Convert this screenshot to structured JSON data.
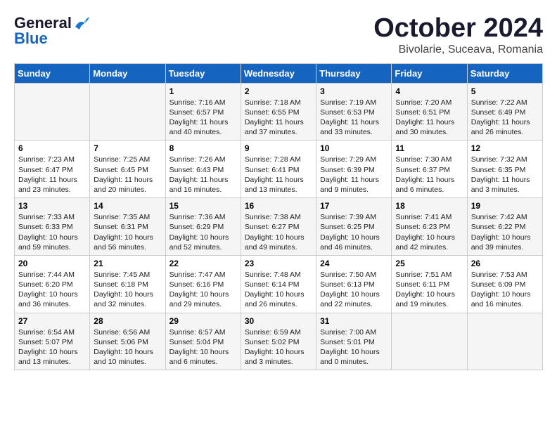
{
  "header": {
    "logo_line1": "General",
    "logo_line2": "Blue",
    "month": "October 2024",
    "location": "Bivolarie, Suceava, Romania"
  },
  "weekdays": [
    "Sunday",
    "Monday",
    "Tuesday",
    "Wednesday",
    "Thursday",
    "Friday",
    "Saturday"
  ],
  "weeks": [
    [
      {
        "day": "",
        "info": ""
      },
      {
        "day": "",
        "info": ""
      },
      {
        "day": "1",
        "info": "Sunrise: 7:16 AM\nSunset: 6:57 PM\nDaylight: 11 hours and 40 minutes."
      },
      {
        "day": "2",
        "info": "Sunrise: 7:18 AM\nSunset: 6:55 PM\nDaylight: 11 hours and 37 minutes."
      },
      {
        "day": "3",
        "info": "Sunrise: 7:19 AM\nSunset: 6:53 PM\nDaylight: 11 hours and 33 minutes."
      },
      {
        "day": "4",
        "info": "Sunrise: 7:20 AM\nSunset: 6:51 PM\nDaylight: 11 hours and 30 minutes."
      },
      {
        "day": "5",
        "info": "Sunrise: 7:22 AM\nSunset: 6:49 PM\nDaylight: 11 hours and 26 minutes."
      }
    ],
    [
      {
        "day": "6",
        "info": "Sunrise: 7:23 AM\nSunset: 6:47 PM\nDaylight: 11 hours and 23 minutes."
      },
      {
        "day": "7",
        "info": "Sunrise: 7:25 AM\nSunset: 6:45 PM\nDaylight: 11 hours and 20 minutes."
      },
      {
        "day": "8",
        "info": "Sunrise: 7:26 AM\nSunset: 6:43 PM\nDaylight: 11 hours and 16 minutes."
      },
      {
        "day": "9",
        "info": "Sunrise: 7:28 AM\nSunset: 6:41 PM\nDaylight: 11 hours and 13 minutes."
      },
      {
        "day": "10",
        "info": "Sunrise: 7:29 AM\nSunset: 6:39 PM\nDaylight: 11 hours and 9 minutes."
      },
      {
        "day": "11",
        "info": "Sunrise: 7:30 AM\nSunset: 6:37 PM\nDaylight: 11 hours and 6 minutes."
      },
      {
        "day": "12",
        "info": "Sunrise: 7:32 AM\nSunset: 6:35 PM\nDaylight: 11 hours and 3 minutes."
      }
    ],
    [
      {
        "day": "13",
        "info": "Sunrise: 7:33 AM\nSunset: 6:33 PM\nDaylight: 10 hours and 59 minutes."
      },
      {
        "day": "14",
        "info": "Sunrise: 7:35 AM\nSunset: 6:31 PM\nDaylight: 10 hours and 56 minutes."
      },
      {
        "day": "15",
        "info": "Sunrise: 7:36 AM\nSunset: 6:29 PM\nDaylight: 10 hours and 52 minutes."
      },
      {
        "day": "16",
        "info": "Sunrise: 7:38 AM\nSunset: 6:27 PM\nDaylight: 10 hours and 49 minutes."
      },
      {
        "day": "17",
        "info": "Sunrise: 7:39 AM\nSunset: 6:25 PM\nDaylight: 10 hours and 46 minutes."
      },
      {
        "day": "18",
        "info": "Sunrise: 7:41 AM\nSunset: 6:23 PM\nDaylight: 10 hours and 42 minutes."
      },
      {
        "day": "19",
        "info": "Sunrise: 7:42 AM\nSunset: 6:22 PM\nDaylight: 10 hours and 39 minutes."
      }
    ],
    [
      {
        "day": "20",
        "info": "Sunrise: 7:44 AM\nSunset: 6:20 PM\nDaylight: 10 hours and 36 minutes."
      },
      {
        "day": "21",
        "info": "Sunrise: 7:45 AM\nSunset: 6:18 PM\nDaylight: 10 hours and 32 minutes."
      },
      {
        "day": "22",
        "info": "Sunrise: 7:47 AM\nSunset: 6:16 PM\nDaylight: 10 hours and 29 minutes."
      },
      {
        "day": "23",
        "info": "Sunrise: 7:48 AM\nSunset: 6:14 PM\nDaylight: 10 hours and 26 minutes."
      },
      {
        "day": "24",
        "info": "Sunrise: 7:50 AM\nSunset: 6:13 PM\nDaylight: 10 hours and 22 minutes."
      },
      {
        "day": "25",
        "info": "Sunrise: 7:51 AM\nSunset: 6:11 PM\nDaylight: 10 hours and 19 minutes."
      },
      {
        "day": "26",
        "info": "Sunrise: 7:53 AM\nSunset: 6:09 PM\nDaylight: 10 hours and 16 minutes."
      }
    ],
    [
      {
        "day": "27",
        "info": "Sunrise: 6:54 AM\nSunset: 5:07 PM\nDaylight: 10 hours and 13 minutes."
      },
      {
        "day": "28",
        "info": "Sunrise: 6:56 AM\nSunset: 5:06 PM\nDaylight: 10 hours and 10 minutes."
      },
      {
        "day": "29",
        "info": "Sunrise: 6:57 AM\nSunset: 5:04 PM\nDaylight: 10 hours and 6 minutes."
      },
      {
        "day": "30",
        "info": "Sunrise: 6:59 AM\nSunset: 5:02 PM\nDaylight: 10 hours and 3 minutes."
      },
      {
        "day": "31",
        "info": "Sunrise: 7:00 AM\nSunset: 5:01 PM\nDaylight: 10 hours and 0 minutes."
      },
      {
        "day": "",
        "info": ""
      },
      {
        "day": "",
        "info": ""
      }
    ]
  ]
}
